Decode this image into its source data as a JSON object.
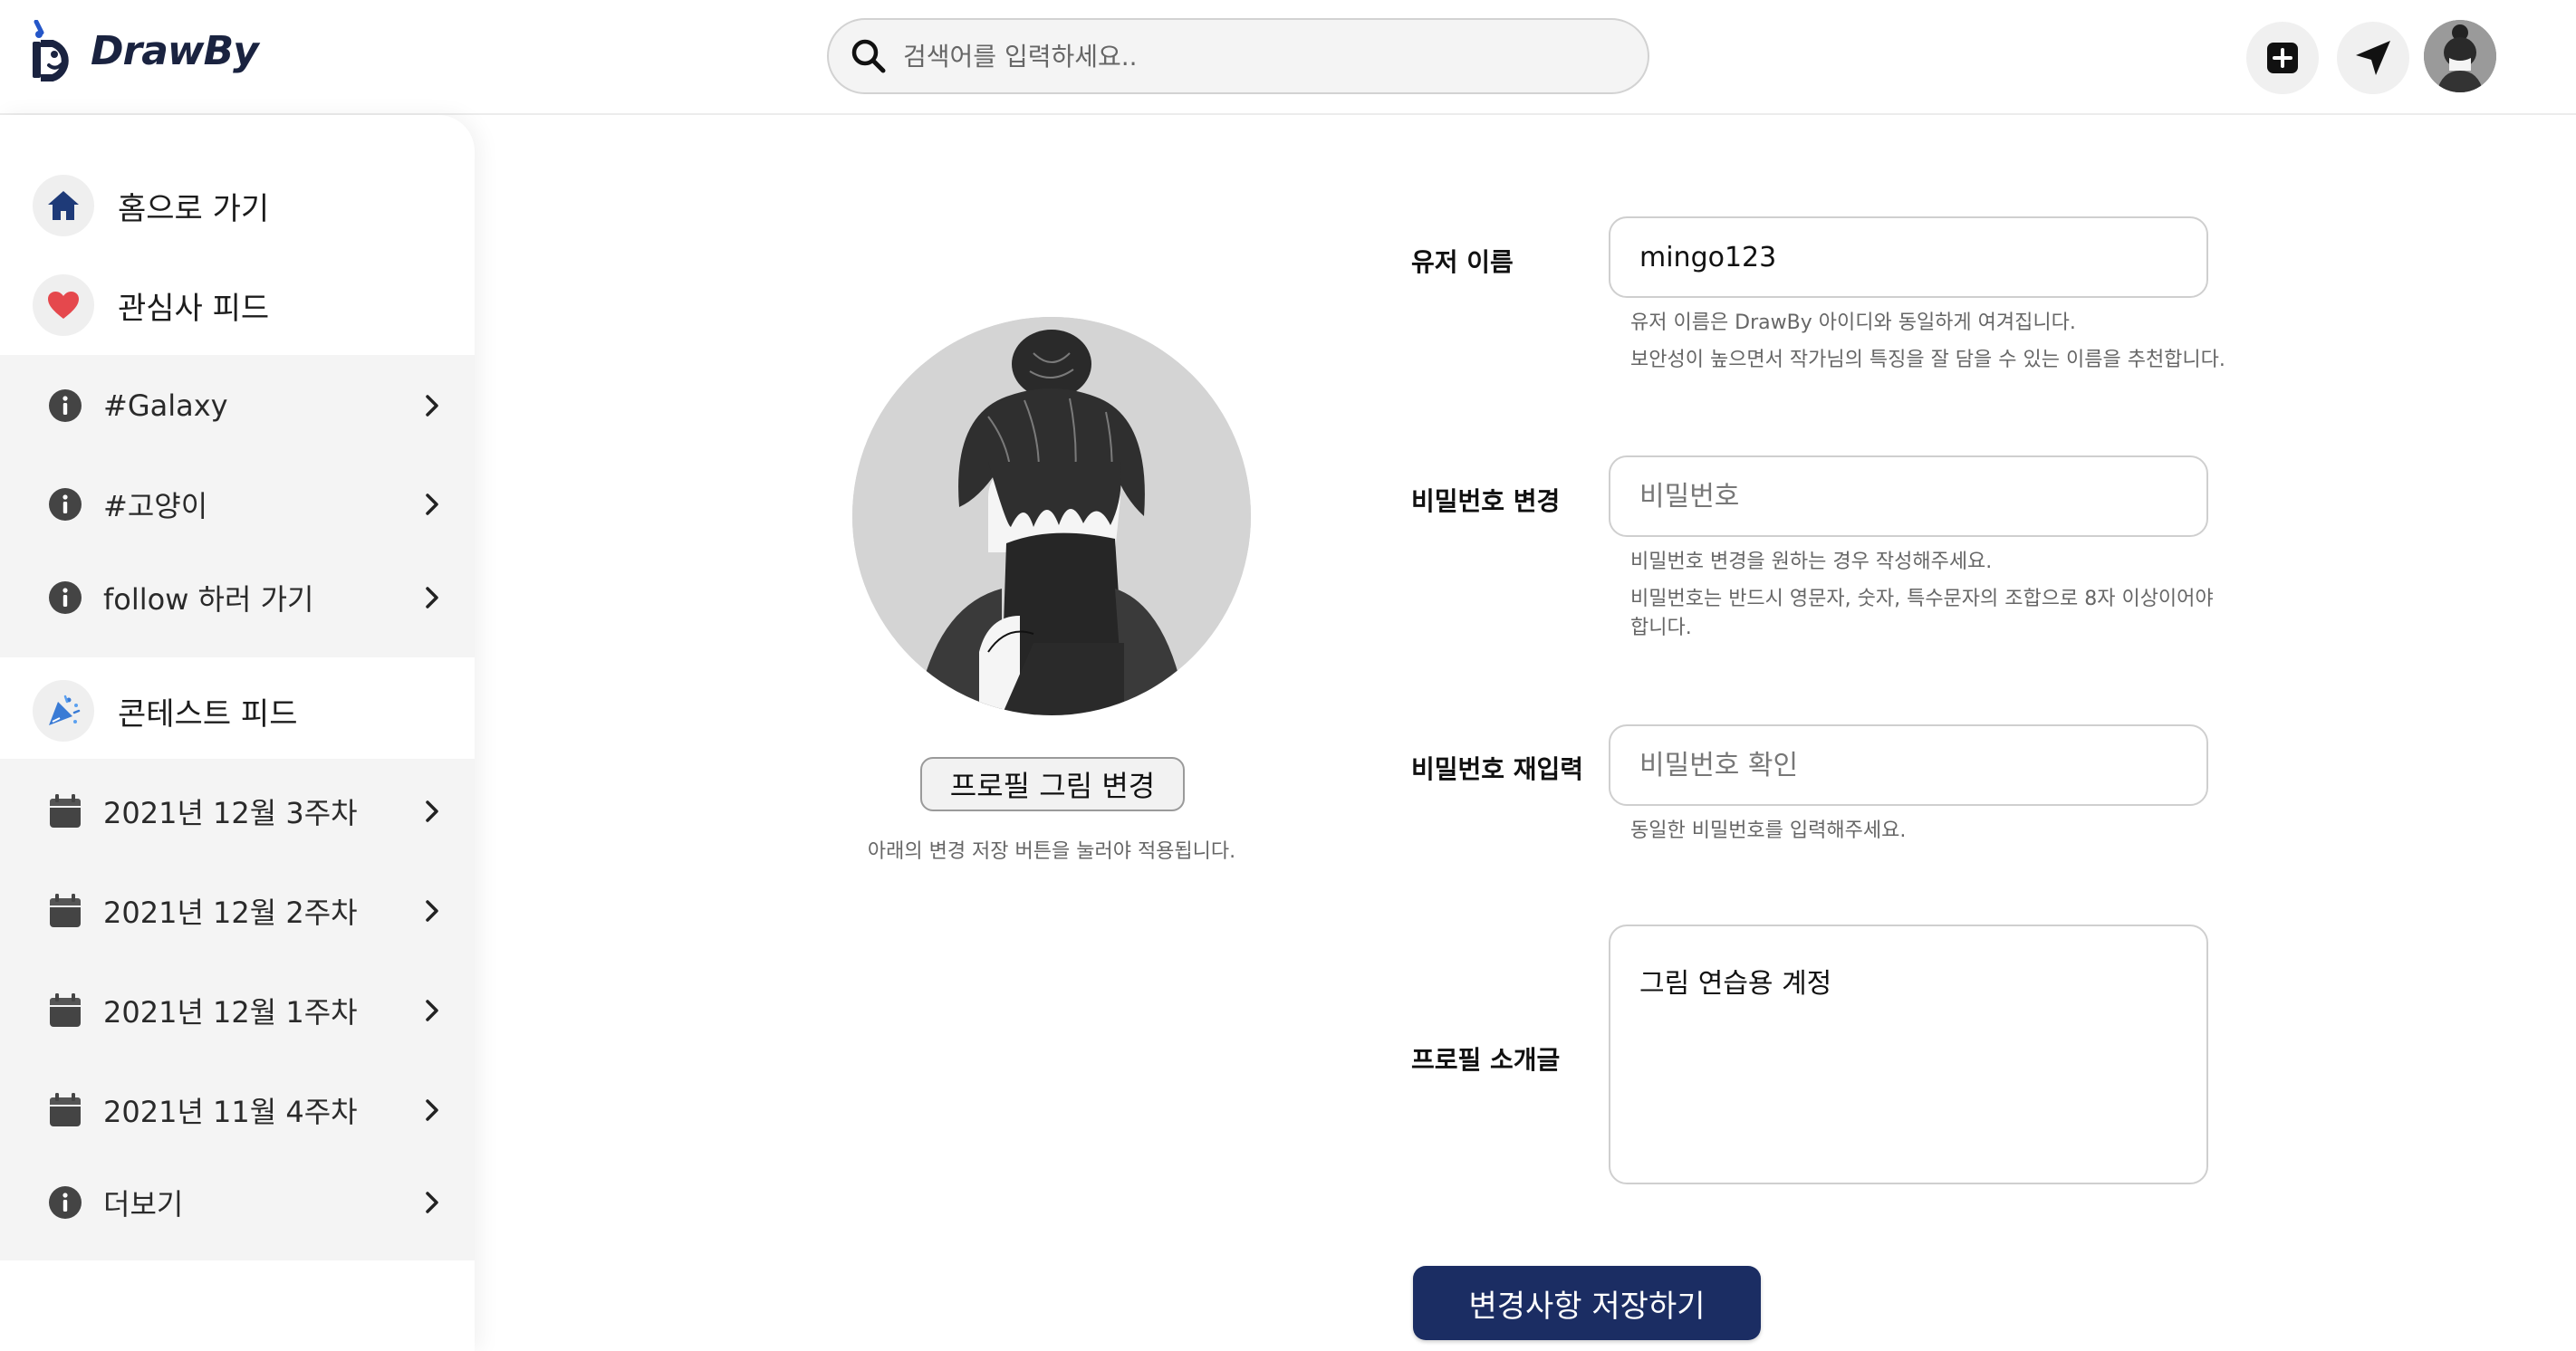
{
  "header": {
    "brand": "DrawBy",
    "search_placeholder": "검색어를 입력하세요.."
  },
  "sidebar": {
    "home_label": "홈으로 가기",
    "interest_feed_label": "관심사 피드",
    "interest_items": [
      {
        "label": "#Galaxy",
        "icon": "info-icon"
      },
      {
        "label": "#고양이",
        "icon": "info-icon"
      },
      {
        "label": "follow 하러 가기",
        "icon": "info-icon"
      }
    ],
    "contest_feed_label": "콘테스트 피드",
    "contest_items": [
      {
        "label": "2021년 12월 3주차",
        "icon": "calendar-icon"
      },
      {
        "label": "2021년 12월 2주차",
        "icon": "calendar-icon"
      },
      {
        "label": "2021년 12월 1주차",
        "icon": "calendar-icon"
      },
      {
        "label": "2021년 11월 4주차",
        "icon": "calendar-icon"
      },
      {
        "label": "더보기",
        "icon": "info-icon"
      }
    ]
  },
  "profile": {
    "change_picture_label": "프로필 그림 변경",
    "change_picture_hint": "아래의 변경 저장 버튼을 눌러야 적용됩니다."
  },
  "form": {
    "username": {
      "label": "유저 이름",
      "value": "mingo123",
      "hint1": "유저 이름은 DrawBy 아이디와 동일하게 여겨집니다.",
      "hint2": "보안성이 높으면서 작가님의 특징을 잘 담을 수 있는 이름을 추천합니다."
    },
    "password": {
      "label": "비밀번호 변경",
      "placeholder": "비밀번호",
      "hint1": "비밀번호 변경을 원하는 경우 작성해주세요.",
      "hint2a": "비밀번호는 반드시 영문자, 숫자, 특수문자의 조합으로 8자 이상이어야",
      "hint2b": "합니다."
    },
    "password_confirm": {
      "label": "비밀번호 재입력",
      "placeholder": "비밀번호 확인",
      "hint": "동일한 비밀번호를 입력해주세요."
    },
    "bio": {
      "label": "프로필 소개글",
      "value": "그림 연습용 계정"
    },
    "save_label": "변경사항 저장하기"
  },
  "colors": {
    "brand_navy": "#1b2d63",
    "heart_red": "#e5484d",
    "home_blue": "#1e3a78"
  }
}
